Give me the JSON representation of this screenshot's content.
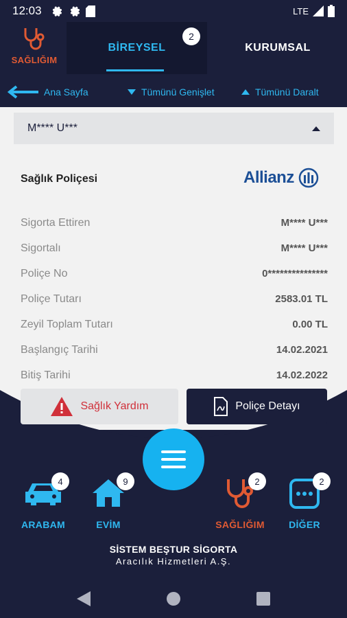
{
  "status_bar": {
    "time": "12:03",
    "network": "LTE"
  },
  "header": {
    "health_label": "SAĞLIĞIM",
    "tabs": [
      {
        "label": "BİREYSEL",
        "badge": "2",
        "active": true
      },
      {
        "label": "KURUMSAL",
        "active": false
      }
    ]
  },
  "nav": {
    "back_label": "Ana Sayfa",
    "expand_label": "Tümünü Genişlet",
    "collapse_label": "Tümünü Daralt"
  },
  "policy": {
    "holder_masked": "M**** U***",
    "title": "Sağlık Poliçesi",
    "insurer_logo_text": "Allianz",
    "rows": [
      {
        "key": "Sigorta Ettiren",
        "value": "M**** U***"
      },
      {
        "key": "Sigortalı",
        "value": "M**** U***"
      },
      {
        "key": "Poliçe No",
        "value": "0***************"
      },
      {
        "key": "Poliçe Tutarı",
        "value": "2583.01 TL"
      },
      {
        "key": "Zeyil Toplam Tutarı",
        "value": "0.00 TL"
      },
      {
        "key": "Başlangıç Tarihi",
        "value": "14.02.2021"
      },
      {
        "key": "Bitiş Tarihi",
        "value": "14.02.2022"
      }
    ]
  },
  "actions": {
    "help_label": "Sağlık Yardım",
    "detail_label": "Poliçe Detayı"
  },
  "categories": [
    {
      "label": "ARABAM",
      "badge": "4"
    },
    {
      "label": "EVİM",
      "badge": "9"
    },
    {
      "label": "SAĞLIĞIM",
      "badge": "2"
    },
    {
      "label": "DİĞER",
      "badge": "2"
    }
  ],
  "footer": {
    "line1": "SİSTEM BEŞTUR SİGORTA",
    "line2": "Aracılık Hizmetleri A.Ş."
  },
  "colors": {
    "navy": "#1b1f3b",
    "accent_blue": "#2fb8f0",
    "health_orange": "#e05a33",
    "alert_red": "#d0303a",
    "allianz_blue": "#1c4f96"
  }
}
